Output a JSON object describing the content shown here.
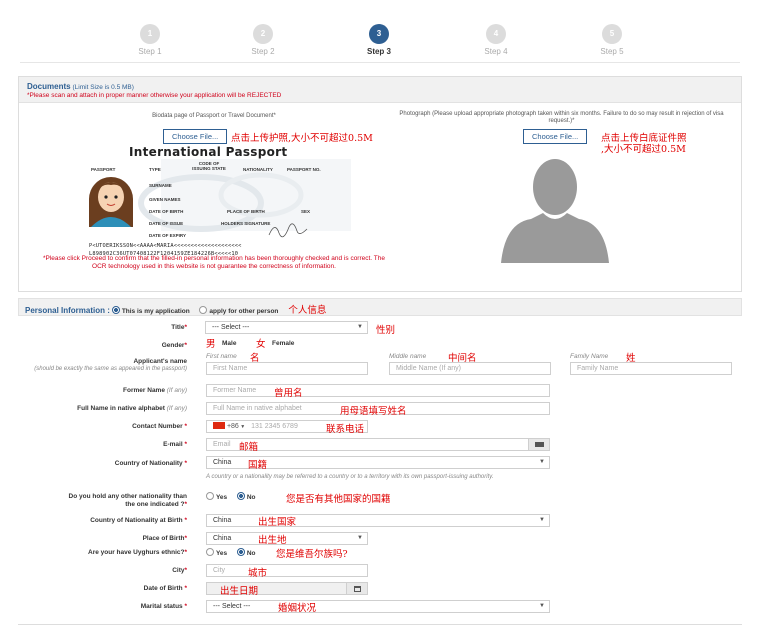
{
  "steps": [
    "Step 1",
    "Step 2",
    "Step 3",
    "Step 4",
    "Step 5"
  ],
  "step_numbers": [
    "1",
    "2",
    "3",
    "4",
    "5"
  ],
  "documents": {
    "title": "Documents",
    "limit": "(Limit Size is 0.5 MB)",
    "warning": "*Please scan and attach in proper manner otherwise your application will be REJECTED",
    "biodata_label": "Biodata page of Passport or Travel Document*",
    "photo_label": "Photograph (Please upload appropriate photograph taken within six months. Failure to do so may result in rejection of visa request.)*",
    "choose_file": "Choose File...",
    "passport_note_cn": "点击上传护照,大小不可超过0.5M",
    "photo_note_cn_1": "点击上传白底证件照",
    "photo_note_cn_2": ",大小不可超过0.5M",
    "notice": "*Please click Proceed to confirm that the filled-in personal information has been thoroughly checked and is correct. The OCR technology used in this website is not guarantee the correctness of information."
  },
  "passport": {
    "title": "International Passport",
    "passport": "PASSPORT",
    "type": "TYPE",
    "code_of_issuing_state": "CODE OF ISSUING STATE",
    "nationality": "NATIONALITY",
    "passport_no": "PASSPORT NO.",
    "surname": "SURNAME",
    "given_names": "GIVEN NAMES",
    "date_of_birth": "DATE OF BIRTH",
    "place_of_birth": "PLACE OF BIRTH",
    "sex": "SEX",
    "date_of_issue": "DATE OF ISSUE",
    "holders_signature": "HOLDERS SIGNATURE",
    "date_of_expiry": "DATE OF EXPIRY",
    "mrz1": "P<UTOERIKSSON<<AAAA<MARIA<<<<<<<<<<<<<<<<<<<<",
    "mrz2": "L898902C36UT07408122F1204159ZE184226B<<<<<10"
  },
  "personal": {
    "title": "Personal Information :",
    "opt_mine": "This is my application",
    "opt_other": "apply for other person",
    "title_cn": "个人信息"
  },
  "form": {
    "title_label": "Title",
    "title_value": "--- Select ---",
    "title_cn": "性别",
    "gender_label": "Gender",
    "male_cn": "男",
    "male": "Male",
    "female_cn": "女",
    "female": "Female",
    "name_label": "Applicant's name",
    "name_note": "(should be exactly the same as appeared in the passport)",
    "first_name_hint": "First name",
    "first_name_cn": "名",
    "first_name_ph": "First Name",
    "middle_name_hint": "Middle name",
    "middle_name_cn": "中间名",
    "middle_name_ph": "Middle Name (If any)",
    "family_name_hint": "Family Name",
    "family_name_cn": "姓",
    "family_name_ph": "Family Name",
    "former_label": "Former Name",
    "if_any": "(If any)",
    "former_ph": "Former Name",
    "former_cn": "曾用名",
    "native_label": "Full Name in native alphabet",
    "native_ph": "Full Name in native alphabet",
    "native_cn": "用母语填写姓名",
    "contact_label": "Contact Number",
    "contact_code": "+86",
    "contact_ph": "131 2345 6789",
    "contact_cn": "联系电话",
    "email_label": "E-mail",
    "email_ph": "Email",
    "email_cn": "邮箱",
    "nationality_label": "Country of Nationality",
    "nationality_value": "China",
    "nationality_cn": "国籍",
    "nationality_note": "A country or a nationality may be referred to a country or to a territory with its own passport-issuing authority.",
    "other_nat_label_1": "Do you hold any other nationality than",
    "other_nat_label_2": "the one indicated ?",
    "yes": "Yes",
    "no": "No",
    "other_nat_cn": "您是否有其他国家的国籍",
    "birth_country_label": "Country of Nationality at Birth",
    "birth_country_value": "China",
    "birth_country_cn": "出生国家",
    "birth_place_label": "Place of Birth",
    "birth_place_value": "China",
    "birth_place_cn": "出生地",
    "uyghur_label": "Are your have Uyghurs ethnic?",
    "uyghur_cn": "您是维吾尔族吗?",
    "city_label": "City",
    "city_ph": "City",
    "city_cn": "城市",
    "dob_label": "Date of Birth",
    "dob_cn": "出生日期",
    "marital_label": "Marital status",
    "marital_value": "--- Select ---",
    "marital_cn": "婚姻状况"
  },
  "colors": {
    "accent": "#2e5f92",
    "required": "#d0021b",
    "annotation": "#e00000"
  }
}
